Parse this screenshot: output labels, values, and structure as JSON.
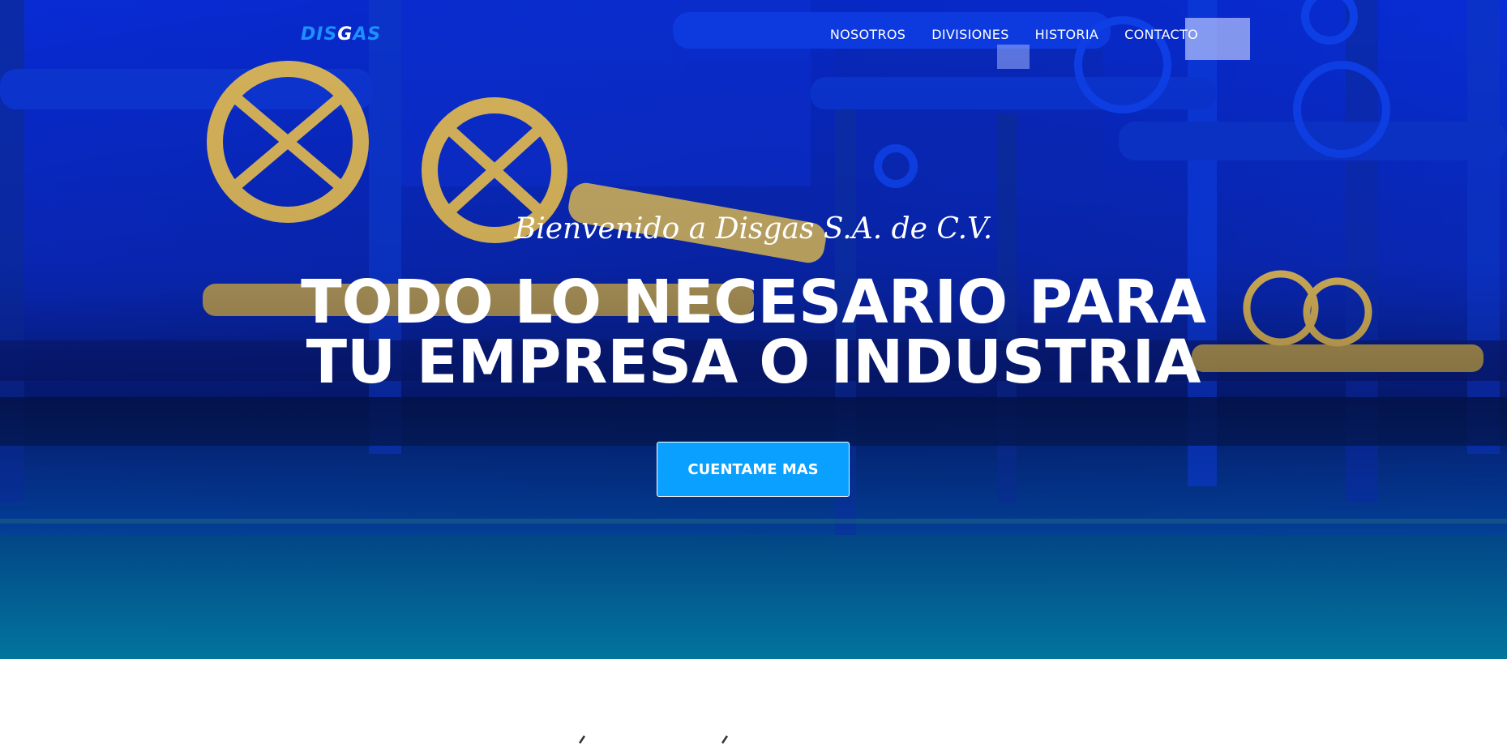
{
  "navbar": {
    "logo_prefix": "DIS",
    "logo_g": "G",
    "logo_suffix": "AS",
    "links": [
      "NOSOTROS",
      "DIVISIONES",
      "HISTORIA",
      "CONTACTO"
    ]
  },
  "hero": {
    "welcome": "Bienvenido a Disgas S.A. de C.V.",
    "headline_line1": "TODO LO NECESARIO PARA",
    "headline_line2": "TU EMPRESA O INDUSTRIA",
    "cta_label": "CUENTAME MAS"
  },
  "colors": {
    "logo_blue": "#1e90ff",
    "cta_blue": "#0aa0ff",
    "hero_blue": "#0b2fd6",
    "hero_teal": "#008ca5"
  }
}
